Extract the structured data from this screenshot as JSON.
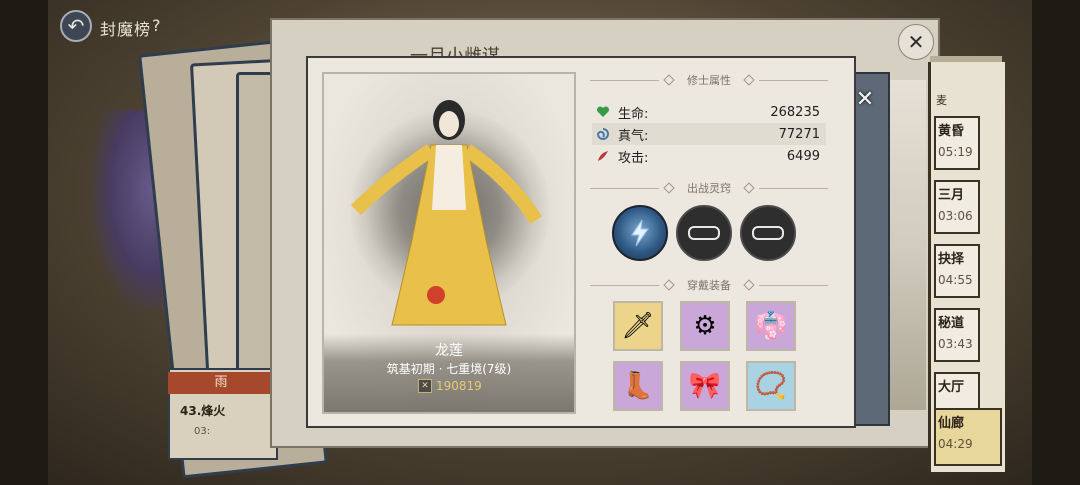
{
  "header": {
    "back_icon": "back-arrow-icon",
    "title": "封魔榜",
    "help": "?"
  },
  "back_panel": {
    "title": "一月小雌谋"
  },
  "background_card": {
    "tag": "雨",
    "name": "43.烽火",
    "time": "03:"
  },
  "rank_list": {
    "header": "麦",
    "items": [
      {
        "name": "黄昏",
        "time": "05:19"
      },
      {
        "name": "三月",
        "time": "03:06"
      },
      {
        "name": "抉择",
        "time": "04:55"
      },
      {
        "name": "秘道",
        "time": "03:43"
      },
      {
        "name": "大厅",
        "time": ""
      },
      {
        "name": "仙廊",
        "time": "04:29"
      }
    ]
  },
  "character": {
    "name": "龙莲",
    "realm": "筑基初期 · 七重境(7级)",
    "power_icon": "crossed-swords-icon",
    "power": "190819"
  },
  "attributes": {
    "title": "修士属性",
    "rows": [
      {
        "icon": "heart-icon",
        "label": "生命:",
        "value": "268235",
        "color": "#3a9a4a"
      },
      {
        "icon": "swirl-icon",
        "label": "真气:",
        "value": "77271",
        "color": "#4a78a8"
      },
      {
        "icon": "feather-icon",
        "label": "攻击:",
        "value": "6499",
        "color": "#b83a3a"
      }
    ]
  },
  "spirit_slots": {
    "title": "出战灵窍",
    "slots": [
      {
        "state": "equipped",
        "icon": "lightning-bolt-icon"
      },
      {
        "state": "locked",
        "icon": "lock-icon"
      },
      {
        "state": "locked",
        "icon": "lock-icon"
      }
    ]
  },
  "equipment": {
    "title": "穿戴装备",
    "items": [
      {
        "rarity": "gold",
        "icon": "dagger-icon",
        "glyph": "🗡"
      },
      {
        "rarity": "purple",
        "icon": "bracer-icon",
        "glyph": "⚙"
      },
      {
        "rarity": "purple",
        "icon": "robe-icon",
        "glyph": "👘"
      },
      {
        "rarity": "purple",
        "icon": "boots-icon",
        "glyph": "👢"
      },
      {
        "rarity": "purple",
        "icon": "ribbon-icon",
        "glyph": "🎀"
      },
      {
        "rarity": "blue",
        "icon": "necklace-icon",
        "glyph": "📿"
      }
    ]
  },
  "close_icon": "close-x-icon"
}
